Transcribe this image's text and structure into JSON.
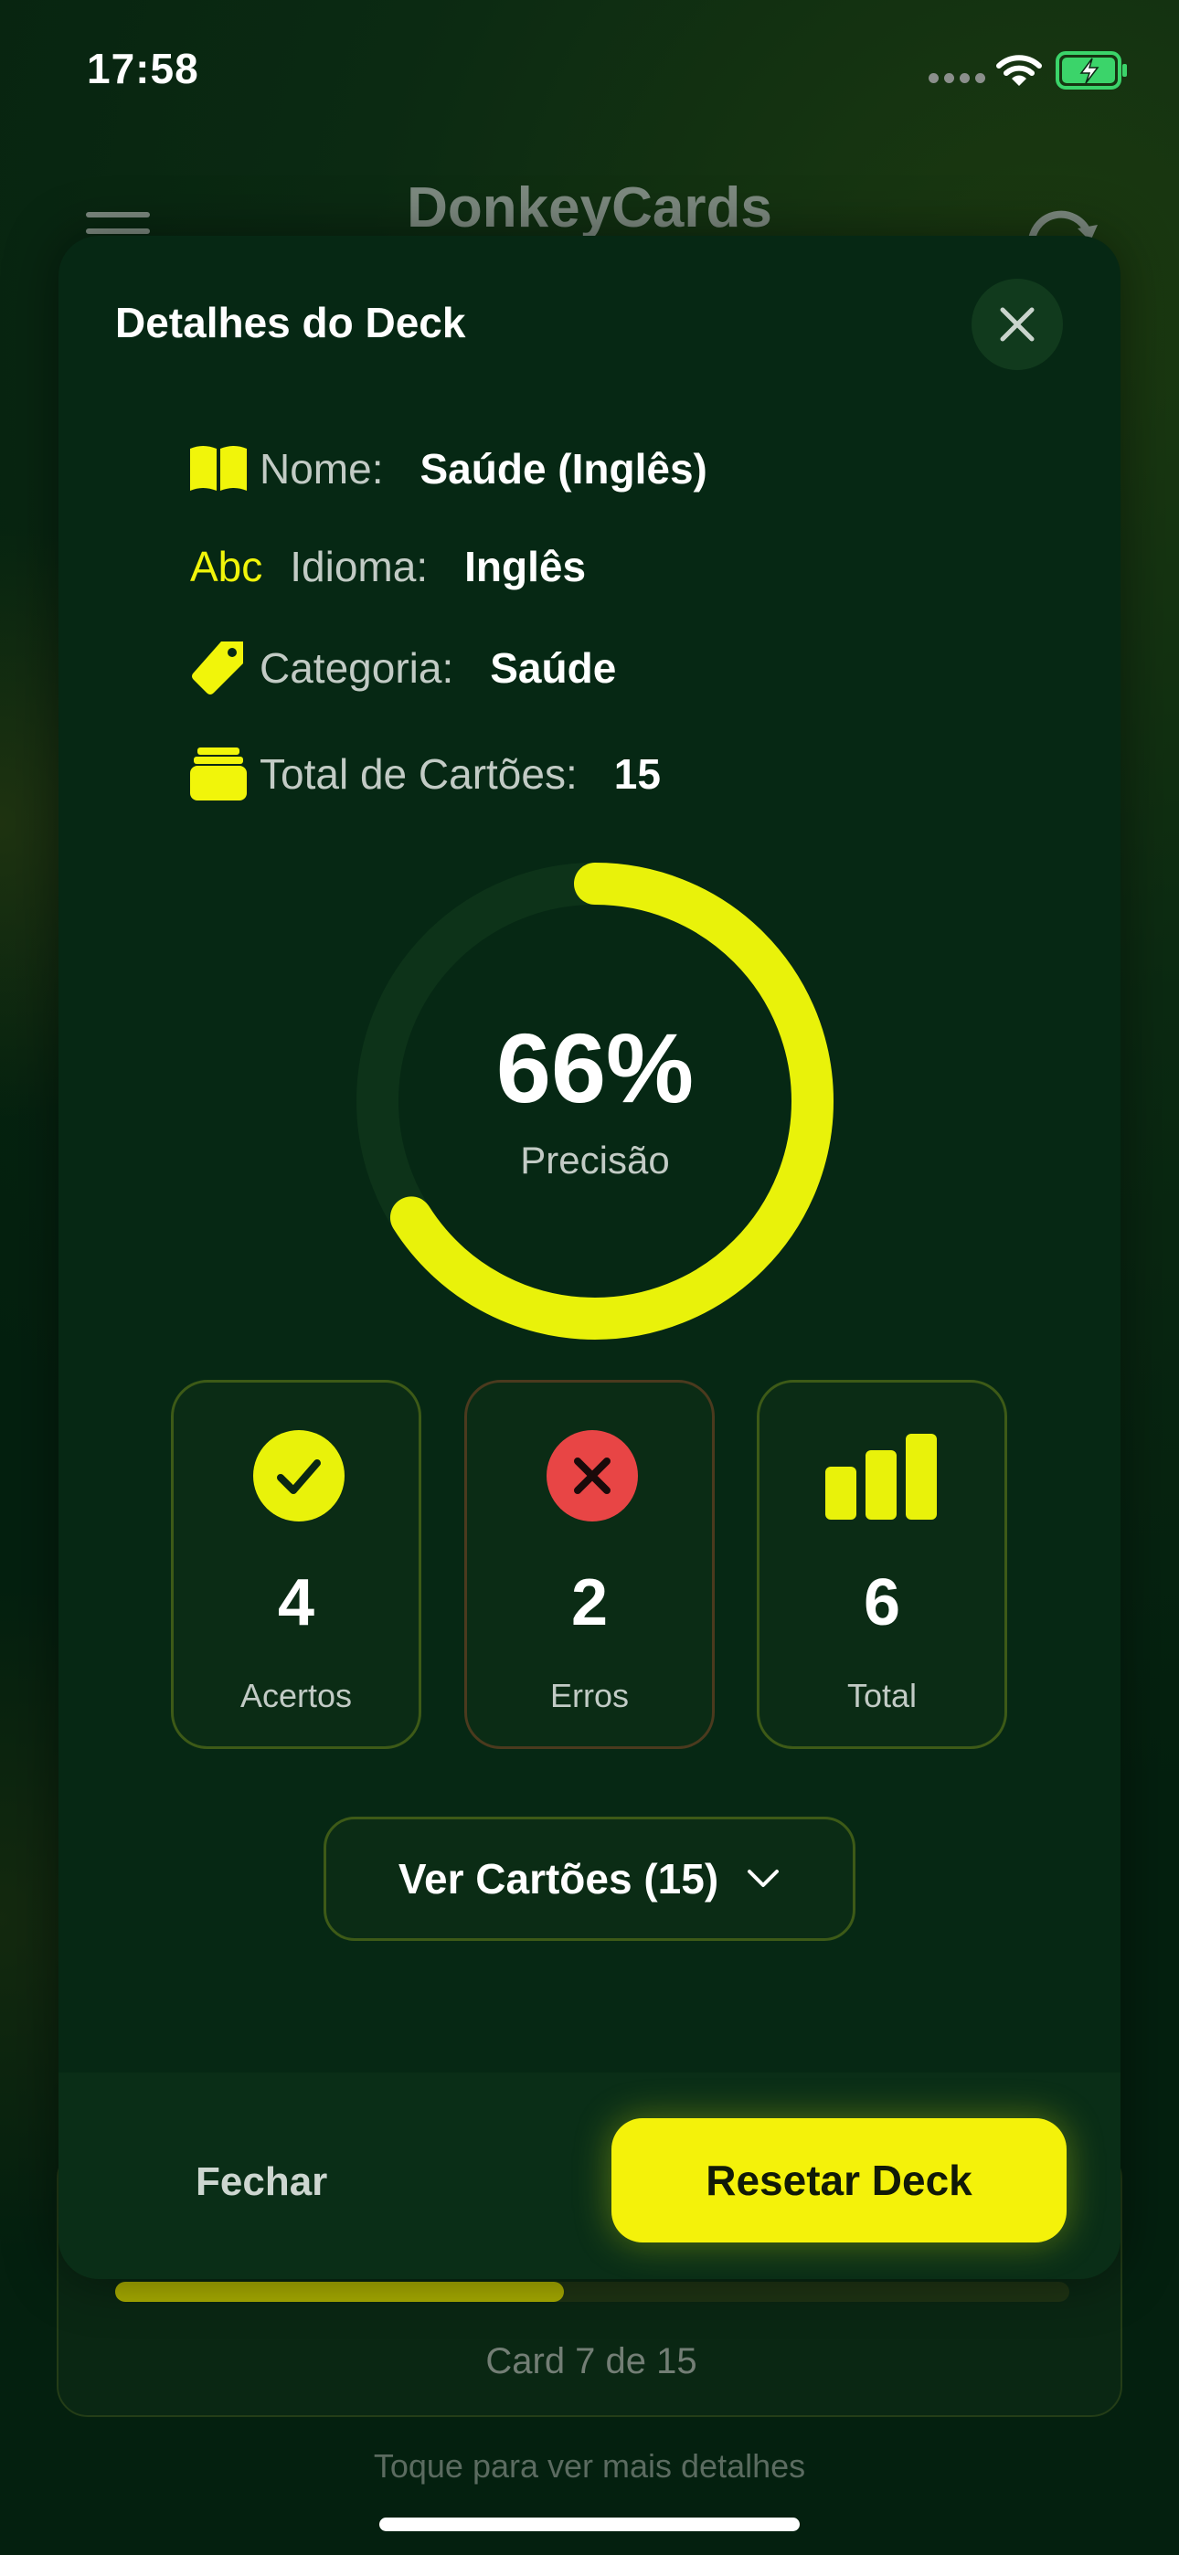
{
  "status_bar": {
    "time": "17:58"
  },
  "app": {
    "title": "DonkeyCards"
  },
  "background_card": {
    "progress": 0.47,
    "label": "Card 7 de 15"
  },
  "hint": "Toque para ver mais detalhes",
  "sheet": {
    "title": "Detalhes do Deck",
    "info": [
      {
        "icon": "book-icon",
        "label": "Nome:",
        "value": "Saúde (Inglês)"
      },
      {
        "icon": "abc-icon",
        "icon_text": "Abc",
        "label": "Idioma:",
        "value": "Inglês"
      },
      {
        "icon": "tag-icon",
        "label": "Categoria:",
        "value": "Saúde"
      },
      {
        "icon": "cards-stack-icon",
        "label": "Total de Cartões:",
        "value": "15"
      }
    ],
    "accuracy": {
      "value": "66%",
      "fraction": 0.66,
      "label": "Precisão"
    },
    "stats": [
      {
        "icon": "check-circle-icon",
        "value": "4",
        "label": "Acertos"
      },
      {
        "icon": "x-circle-icon",
        "value": "2",
        "label": "Erros"
      },
      {
        "icon": "bar-chart-icon",
        "value": "6",
        "label": "Total"
      }
    ],
    "view_cards_button": "Ver Cartões (15)",
    "close_button": "Fechar",
    "reset_button": "Resetar Deck"
  },
  "colors": {
    "accent": "#f4f20a",
    "background": "#04200f",
    "sheet": "#062814",
    "error": "#e84545"
  }
}
